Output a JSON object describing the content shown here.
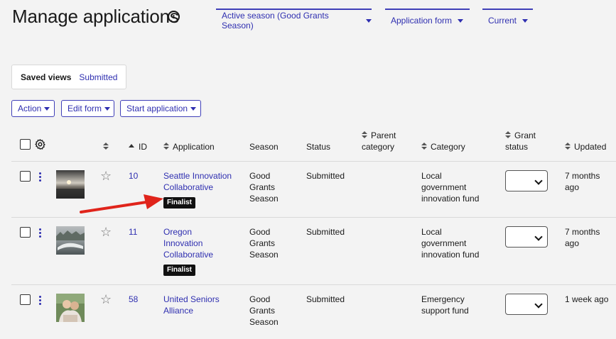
{
  "page": {
    "title": "Manage applications",
    "info_icon": "i"
  },
  "filters": [
    {
      "label": "Active season (Good Grants Season)"
    },
    {
      "label": "Application form"
    },
    {
      "label": "Current"
    }
  ],
  "saved_views": {
    "label": "Saved views",
    "link": "Submitted"
  },
  "actions": {
    "action": "Action",
    "edit_form": "Edit form",
    "start_application": "Start application"
  },
  "columns": {
    "id": "ID",
    "application": "Application",
    "season": "Season",
    "status": "Status",
    "parent_category_1": "Parent",
    "parent_category_2": "category",
    "category": "Category",
    "grant_status_1": "Grant",
    "grant_status_2": "status",
    "updated": "Updated"
  },
  "rows": [
    {
      "id": "10",
      "app_line1": "Seattle Innovation",
      "app_line2": "Collaborative",
      "app_line3": "",
      "badge": "Finalist",
      "season1": "Good",
      "season2": "Grants",
      "season3": "Season",
      "status": "Submitted",
      "cat1": "Local",
      "cat2": "government",
      "cat3": "innovation fund",
      "upd1": "7 months",
      "upd2": "ago"
    },
    {
      "id": "11",
      "app_line1": "Oregon",
      "app_line2": "Innovation",
      "app_line3": "Collaborative",
      "badge": "Finalist",
      "season1": "Good",
      "season2": "Grants",
      "season3": "Season",
      "status": "Submitted",
      "cat1": "Local",
      "cat2": "government",
      "cat3": "innovation fund",
      "upd1": "7 months",
      "upd2": "ago"
    },
    {
      "id": "58",
      "app_line1": "United Seniors",
      "app_line2": "Alliance",
      "app_line3": "",
      "badge": "",
      "season1": "Good",
      "season2": "Grants",
      "season3": "Season",
      "status": "Submitted",
      "cat1": "Emergency",
      "cat2": "support fund",
      "cat3": "",
      "upd1": "1 week ago",
      "upd2": ""
    }
  ],
  "colors": {
    "accent": "#2f2fb0",
    "arrow": "#e0241b",
    "badge": "#111111"
  }
}
